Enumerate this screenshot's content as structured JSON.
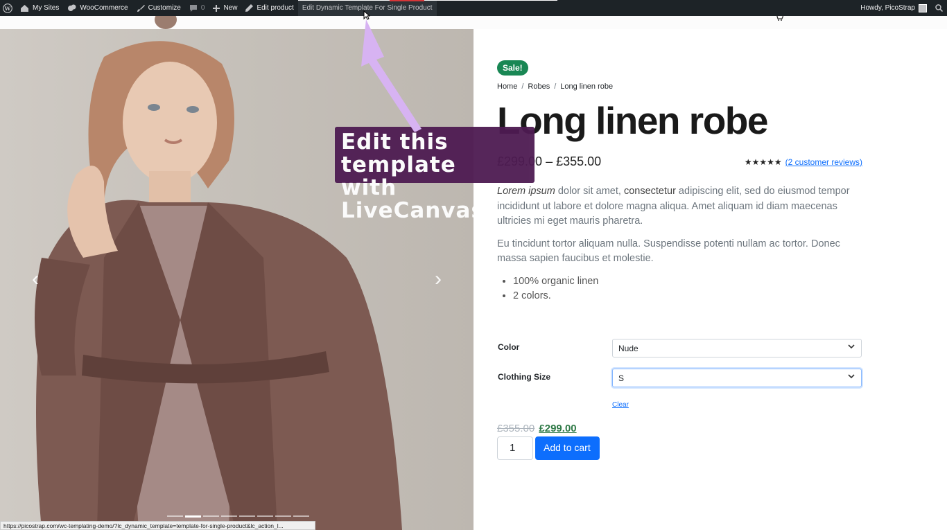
{
  "adminbar": {
    "items": [
      {
        "icon": "wordpress-icon",
        "label": ""
      },
      {
        "icon": "my-sites-icon",
        "label": "My Sites"
      },
      {
        "icon": "woocommerce-icon",
        "label": "WooCommerce"
      },
      {
        "icon": "brush-icon",
        "label": "Customize"
      },
      {
        "icon": "comment-icon",
        "label": "0"
      },
      {
        "icon": "plus-icon",
        "label": "New"
      },
      {
        "icon": "pencil-icon",
        "label": "Edit product"
      },
      {
        "icon": "",
        "label": "Edit Dynamic Template For Single Product"
      }
    ],
    "greeting": "Howdy, PicoStrap"
  },
  "callout": {
    "line1": "Edit this template",
    "line2": "with LiveCanvas",
    "color": "#4e1b52",
    "arrow_color": "#d7b3f2"
  },
  "gallery": {
    "prev": "‹",
    "next": "›",
    "slides": 8,
    "active_slide": 2
  },
  "status_bar": {
    "url": "https://picostrap.com/wc-templating-demo/?lc_dynamic_template=template-for-single-product&lc_action_l..."
  },
  "product": {
    "badge": "Sale!",
    "breadcrumb": [
      "Home",
      "Robes",
      "Long linen robe"
    ],
    "title": "Long linen robe",
    "price_range": "£299.00 – £355.00",
    "stars": "★★★★★",
    "reviews_link": "(2 customer reviews)",
    "desc": {
      "p1_em": "Lorem ipsum",
      "p1_a": " dolor sit amet, ",
      "p1_strong": "consectetur",
      "p1_b": " adipiscing elit, sed do eiusmod tempor incididunt ut labore et dolore magna aliqua. Amet aliquam id diam maecenas ultricies mi eget mauris pharetra.",
      "p2": "Eu tincidunt tortor aliquam nulla. Suspendisse potenti nullam ac tortor. Donec massa sapien faucibus et molestie.",
      "bullets": [
        "100% organic linen",
        "2 colors."
      ]
    },
    "variations": [
      {
        "label": "Color",
        "value": "Nude"
      },
      {
        "label": "Clothing Size",
        "value": "S"
      }
    ],
    "clear": "Clear",
    "old_price": "£355.00",
    "new_price": "£299.00",
    "quantity": "1",
    "add_to_cart": "Add to cart",
    "sale_color": "#198754",
    "button_color": "#0d6efd"
  }
}
